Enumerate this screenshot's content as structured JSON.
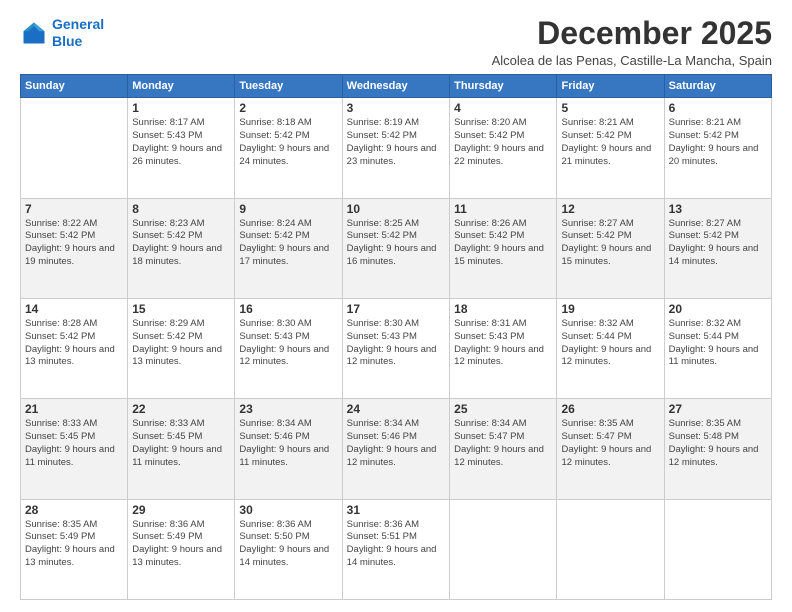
{
  "header": {
    "logo_line1": "General",
    "logo_line2": "Blue",
    "month": "December 2025",
    "location": "Alcolea de las Penas, Castille-La Mancha, Spain"
  },
  "weekdays": [
    "Sunday",
    "Monday",
    "Tuesday",
    "Wednesday",
    "Thursday",
    "Friday",
    "Saturday"
  ],
  "weeks": [
    [
      {
        "day": "",
        "sunrise": "",
        "sunset": "",
        "daylight": ""
      },
      {
        "day": "1",
        "sunrise": "Sunrise: 8:17 AM",
        "sunset": "Sunset: 5:43 PM",
        "daylight": "Daylight: 9 hours and 26 minutes."
      },
      {
        "day": "2",
        "sunrise": "Sunrise: 8:18 AM",
        "sunset": "Sunset: 5:42 PM",
        "daylight": "Daylight: 9 hours and 24 minutes."
      },
      {
        "day": "3",
        "sunrise": "Sunrise: 8:19 AM",
        "sunset": "Sunset: 5:42 PM",
        "daylight": "Daylight: 9 hours and 23 minutes."
      },
      {
        "day": "4",
        "sunrise": "Sunrise: 8:20 AM",
        "sunset": "Sunset: 5:42 PM",
        "daylight": "Daylight: 9 hours and 22 minutes."
      },
      {
        "day": "5",
        "sunrise": "Sunrise: 8:21 AM",
        "sunset": "Sunset: 5:42 PM",
        "daylight": "Daylight: 9 hours and 21 minutes."
      },
      {
        "day": "6",
        "sunrise": "Sunrise: 8:21 AM",
        "sunset": "Sunset: 5:42 PM",
        "daylight": "Daylight: 9 hours and 20 minutes."
      }
    ],
    [
      {
        "day": "7",
        "sunrise": "Sunrise: 8:22 AM",
        "sunset": "Sunset: 5:42 PM",
        "daylight": "Daylight: 9 hours and 19 minutes."
      },
      {
        "day": "8",
        "sunrise": "Sunrise: 8:23 AM",
        "sunset": "Sunset: 5:42 PM",
        "daylight": "Daylight: 9 hours and 18 minutes."
      },
      {
        "day": "9",
        "sunrise": "Sunrise: 8:24 AM",
        "sunset": "Sunset: 5:42 PM",
        "daylight": "Daylight: 9 hours and 17 minutes."
      },
      {
        "day": "10",
        "sunrise": "Sunrise: 8:25 AM",
        "sunset": "Sunset: 5:42 PM",
        "daylight": "Daylight: 9 hours and 16 minutes."
      },
      {
        "day": "11",
        "sunrise": "Sunrise: 8:26 AM",
        "sunset": "Sunset: 5:42 PM",
        "daylight": "Daylight: 9 hours and 15 minutes."
      },
      {
        "day": "12",
        "sunrise": "Sunrise: 8:27 AM",
        "sunset": "Sunset: 5:42 PM",
        "daylight": "Daylight: 9 hours and 15 minutes."
      },
      {
        "day": "13",
        "sunrise": "Sunrise: 8:27 AM",
        "sunset": "Sunset: 5:42 PM",
        "daylight": "Daylight: 9 hours and 14 minutes."
      }
    ],
    [
      {
        "day": "14",
        "sunrise": "Sunrise: 8:28 AM",
        "sunset": "Sunset: 5:42 PM",
        "daylight": "Daylight: 9 hours and 13 minutes."
      },
      {
        "day": "15",
        "sunrise": "Sunrise: 8:29 AM",
        "sunset": "Sunset: 5:42 PM",
        "daylight": "Daylight: 9 hours and 13 minutes."
      },
      {
        "day": "16",
        "sunrise": "Sunrise: 8:30 AM",
        "sunset": "Sunset: 5:43 PM",
        "daylight": "Daylight: 9 hours and 12 minutes."
      },
      {
        "day": "17",
        "sunrise": "Sunrise: 8:30 AM",
        "sunset": "Sunset: 5:43 PM",
        "daylight": "Daylight: 9 hours and 12 minutes."
      },
      {
        "day": "18",
        "sunrise": "Sunrise: 8:31 AM",
        "sunset": "Sunset: 5:43 PM",
        "daylight": "Daylight: 9 hours and 12 minutes."
      },
      {
        "day": "19",
        "sunrise": "Sunrise: 8:32 AM",
        "sunset": "Sunset: 5:44 PM",
        "daylight": "Daylight: 9 hours and 12 minutes."
      },
      {
        "day": "20",
        "sunrise": "Sunrise: 8:32 AM",
        "sunset": "Sunset: 5:44 PM",
        "daylight": "Daylight: 9 hours and 11 minutes."
      }
    ],
    [
      {
        "day": "21",
        "sunrise": "Sunrise: 8:33 AM",
        "sunset": "Sunset: 5:45 PM",
        "daylight": "Daylight: 9 hours and 11 minutes."
      },
      {
        "day": "22",
        "sunrise": "Sunrise: 8:33 AM",
        "sunset": "Sunset: 5:45 PM",
        "daylight": "Daylight: 9 hours and 11 minutes."
      },
      {
        "day": "23",
        "sunrise": "Sunrise: 8:34 AM",
        "sunset": "Sunset: 5:46 PM",
        "daylight": "Daylight: 9 hours and 11 minutes."
      },
      {
        "day": "24",
        "sunrise": "Sunrise: 8:34 AM",
        "sunset": "Sunset: 5:46 PM",
        "daylight": "Daylight: 9 hours and 12 minutes."
      },
      {
        "day": "25",
        "sunrise": "Sunrise: 8:34 AM",
        "sunset": "Sunset: 5:47 PM",
        "daylight": "Daylight: 9 hours and 12 minutes."
      },
      {
        "day": "26",
        "sunrise": "Sunrise: 8:35 AM",
        "sunset": "Sunset: 5:47 PM",
        "daylight": "Daylight: 9 hours and 12 minutes."
      },
      {
        "day": "27",
        "sunrise": "Sunrise: 8:35 AM",
        "sunset": "Sunset: 5:48 PM",
        "daylight": "Daylight: 9 hours and 12 minutes."
      }
    ],
    [
      {
        "day": "28",
        "sunrise": "Sunrise: 8:35 AM",
        "sunset": "Sunset: 5:49 PM",
        "daylight": "Daylight: 9 hours and 13 minutes."
      },
      {
        "day": "29",
        "sunrise": "Sunrise: 8:36 AM",
        "sunset": "Sunset: 5:49 PM",
        "daylight": "Daylight: 9 hours and 13 minutes."
      },
      {
        "day": "30",
        "sunrise": "Sunrise: 8:36 AM",
        "sunset": "Sunset: 5:50 PM",
        "daylight": "Daylight: 9 hours and 14 minutes."
      },
      {
        "day": "31",
        "sunrise": "Sunrise: 8:36 AM",
        "sunset": "Sunset: 5:51 PM",
        "daylight": "Daylight: 9 hours and 14 minutes."
      },
      {
        "day": "",
        "sunrise": "",
        "sunset": "",
        "daylight": ""
      },
      {
        "day": "",
        "sunrise": "",
        "sunset": "",
        "daylight": ""
      },
      {
        "day": "",
        "sunrise": "",
        "sunset": "",
        "daylight": ""
      }
    ]
  ]
}
